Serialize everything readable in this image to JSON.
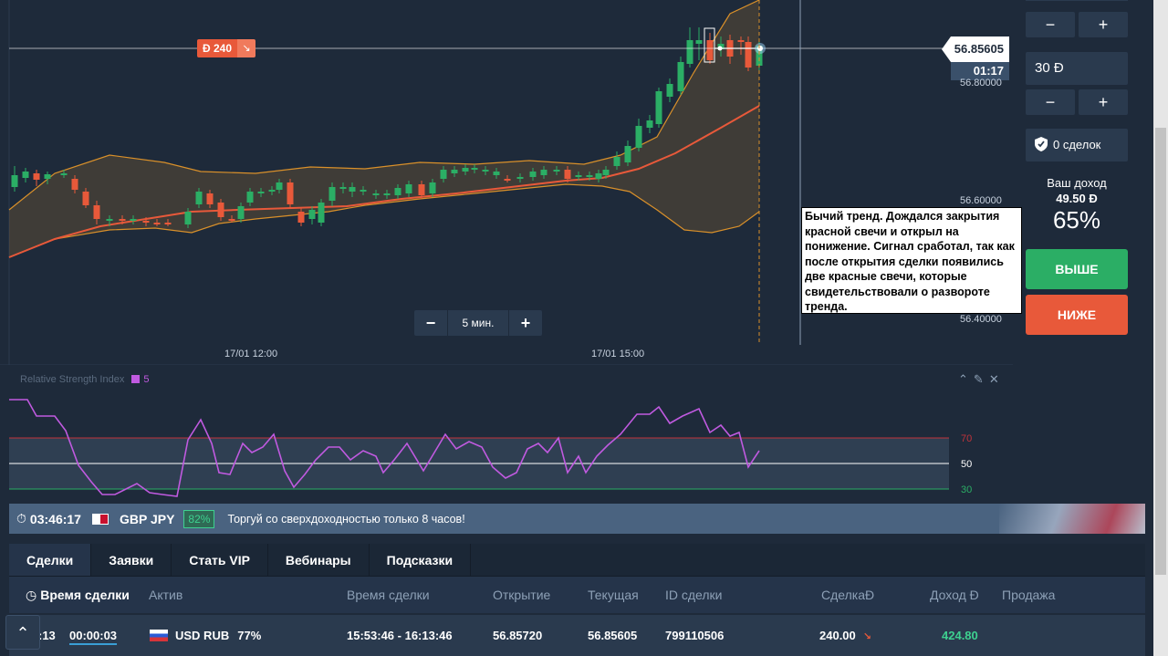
{
  "chart": {
    "current_price": "56.85605",
    "timer": "01:17",
    "price_axis": [
      "56.80000",
      "56.60000",
      "56.40000"
    ],
    "time_axis": [
      "17/01 12:00",
      "17/01 15:00"
    ],
    "deal_amount": "Đ 240",
    "deal_arrow": "↘",
    "timeframe": "5 мин.",
    "annotation": "Бычий тренд. Дождался закрытия красной свечи и открыл на понижение.  Сигнал сработал, так как после открытия сделки появились две красные свечи, которые свидетельствовали о развороте тренда.",
    "colors": {
      "bull": "#2bae65",
      "bear": "#e8593a",
      "band": "#d9902a",
      "ma": "#e8593a"
    }
  },
  "rsi": {
    "title": "Relative Strength Index",
    "period": "5",
    "levels": [
      "70",
      "50",
      "30"
    ],
    "icons": [
      "chevron-up-icon",
      "pencil-icon",
      "close-icon"
    ],
    "colors": {
      "line": "#c05ae0",
      "upper": "#c0333a",
      "mid": "#ffffff",
      "lower": "#2bae65"
    }
  },
  "side": {
    "minus": "−",
    "plus": "+",
    "amount": "30 Đ",
    "deals": "0 сделок",
    "income_label": "Ваш доход",
    "income_value": "49.50 Đ",
    "income_pct": "65%",
    "up": "ВЫШЕ",
    "down": "НИЖЕ"
  },
  "ticker": {
    "time": "03:46:17",
    "pair": "GBP JPY",
    "pct": "82%",
    "message": "Торгуй со сверхдоходностью только 8 часов!"
  },
  "tabs": [
    "Сделки",
    "Заявки",
    "Стать VIP",
    "Вебинары",
    "Подсказки"
  ],
  "table": {
    "headers": [
      "Время сделки",
      "Актив",
      "Время сделки",
      "Открытие",
      "Текущая",
      "ID сделки",
      "СделкаĐ",
      "Доход Đ",
      "Продажа"
    ],
    "row": {
      "expiry": ":13",
      "countdown": "00:00:03",
      "asset": "USD RUB",
      "asset_pct": "77%",
      "period": "15:53:46 - 16:13:46",
      "open": "56.85720",
      "current": "56.85605",
      "id": "799110506",
      "amount": "240.00",
      "arrow": "↘",
      "profit": "424.80"
    }
  },
  "scroll_up": "^"
}
